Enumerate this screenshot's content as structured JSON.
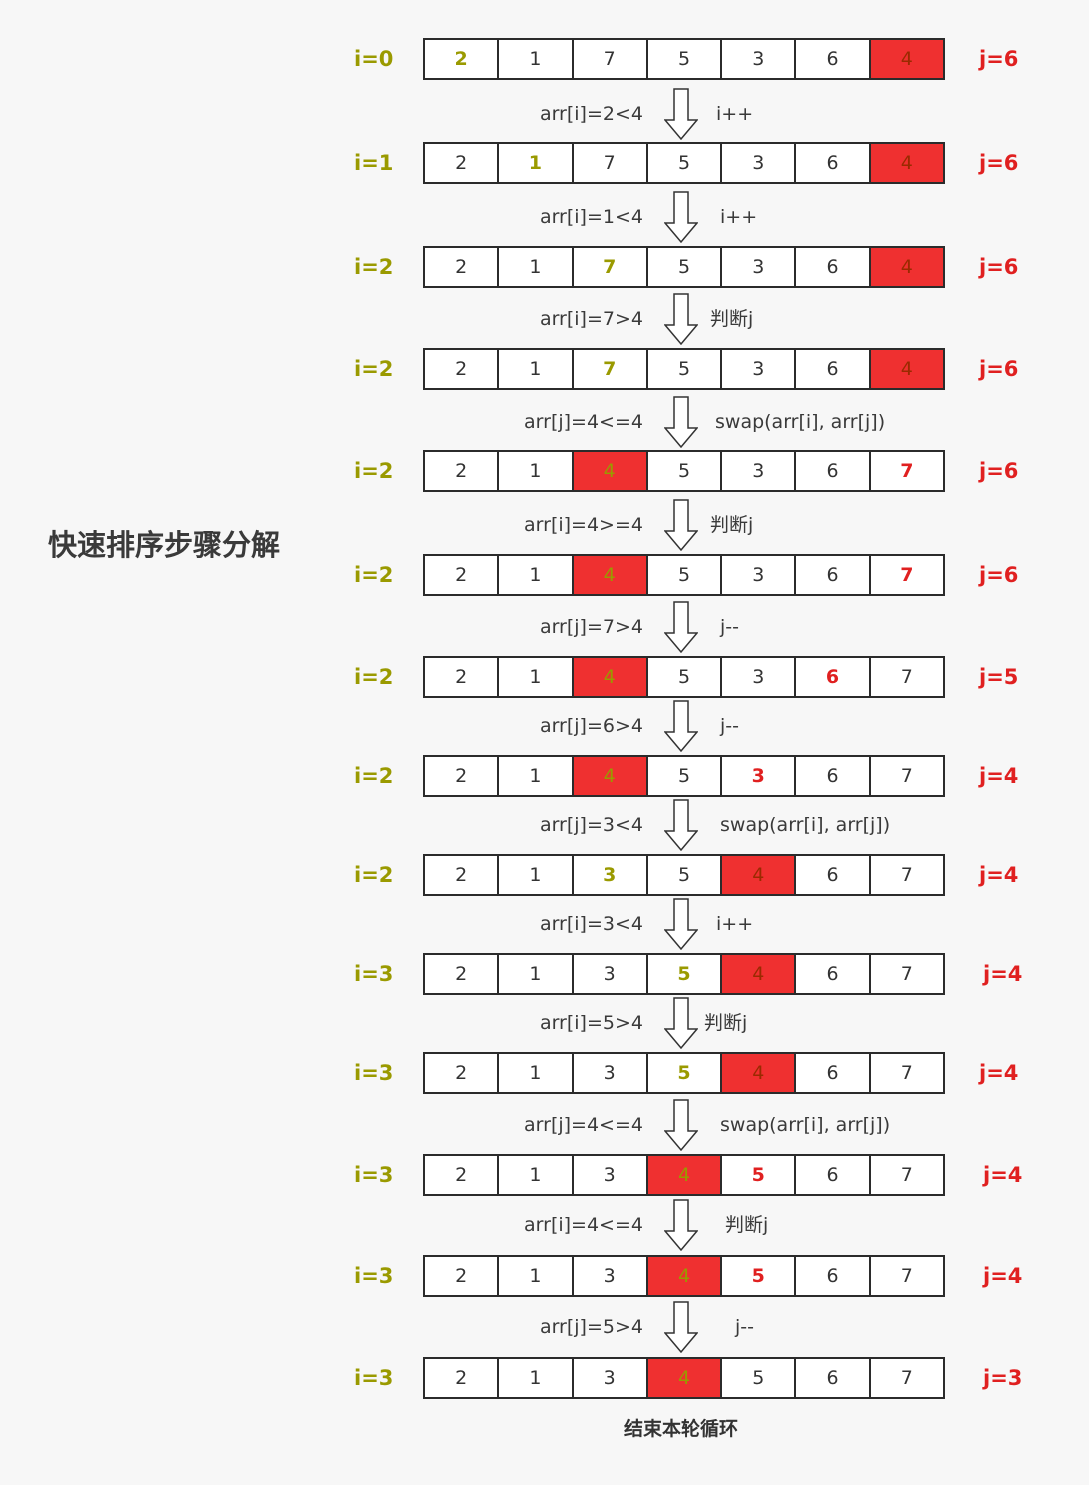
{
  "title": "快速排序步骤分解",
  "footer": "结束本轮循环",
  "colors": {
    "pivot_red": "#ef3030",
    "i_color": "#9a9a00",
    "j_color": "#e02020"
  },
  "rows": [
    {
      "i": "i=0",
      "j": "j=6",
      "cells": [
        "2",
        "1",
        "7",
        "5",
        "3",
        "6",
        "4"
      ],
      "red": [
        6
      ],
      "hi_i": 0,
      "hi_j": null
    },
    {
      "i": "i=1",
      "j": "j=6",
      "cells": [
        "2",
        "1",
        "7",
        "5",
        "3",
        "6",
        "4"
      ],
      "red": [
        6
      ],
      "hi_i": 1,
      "hi_j": null
    },
    {
      "i": "i=2",
      "j": "j=6",
      "cells": [
        "2",
        "1",
        "7",
        "5",
        "3",
        "6",
        "4"
      ],
      "red": [
        6
      ],
      "hi_i": 2,
      "hi_j": null
    },
    {
      "i": "i=2",
      "j": "j=6",
      "cells": [
        "2",
        "1",
        "7",
        "5",
        "3",
        "6",
        "4"
      ],
      "red": [
        6
      ],
      "hi_i": 2,
      "hi_j": null
    },
    {
      "i": "i=2",
      "j": "j=6",
      "cells": [
        "2",
        "1",
        "4",
        "5",
        "3",
        "6",
        "7"
      ],
      "red": [
        2
      ],
      "hi_i": 2,
      "hi_j": 6
    },
    {
      "i": "i=2",
      "j": "j=6",
      "cells": [
        "2",
        "1",
        "4",
        "5",
        "3",
        "6",
        "7"
      ],
      "red": [
        2
      ],
      "hi_i": 2,
      "hi_j": 6
    },
    {
      "i": "i=2",
      "j": "j=5",
      "cells": [
        "2",
        "1",
        "4",
        "5",
        "3",
        "6",
        "7"
      ],
      "red": [
        2
      ],
      "hi_i": 2,
      "hi_j": 5
    },
    {
      "i": "i=2",
      "j": "j=4",
      "cells": [
        "2",
        "1",
        "4",
        "5",
        "3",
        "6",
        "7"
      ],
      "red": [
        2
      ],
      "hi_i": 2,
      "hi_j": 4
    },
    {
      "i": "i=2",
      "j": "j=4",
      "cells": [
        "2",
        "1",
        "3",
        "5",
        "4",
        "6",
        "7"
      ],
      "red": [
        4
      ],
      "hi_i": 2,
      "hi_j": null
    },
    {
      "i": "i=3",
      "j": "j=4",
      "cells": [
        "2",
        "1",
        "3",
        "5",
        "4",
        "6",
        "7"
      ],
      "red": [
        4
      ],
      "hi_i": 3,
      "hi_j": null
    },
    {
      "i": "i=3",
      "j": "j=4",
      "cells": [
        "2",
        "1",
        "3",
        "5",
        "4",
        "6",
        "7"
      ],
      "red": [
        4
      ],
      "hi_i": 3,
      "hi_j": null
    },
    {
      "i": "i=3",
      "j": "j=4",
      "cells": [
        "2",
        "1",
        "3",
        "4",
        "5",
        "6",
        "7"
      ],
      "red": [
        3
      ],
      "hi_i": 3,
      "hi_j": 4
    },
    {
      "i": "i=3",
      "j": "j=4",
      "cells": [
        "2",
        "1",
        "3",
        "4",
        "5",
        "6",
        "7"
      ],
      "red": [
        3
      ],
      "hi_i": 3,
      "hi_j": 4
    },
    {
      "i": "i=3",
      "j": "j=3",
      "cells": [
        "2",
        "1",
        "3",
        "4",
        "5",
        "6",
        "7"
      ],
      "red": [
        3
      ],
      "hi_i": 3,
      "hi_j": null
    }
  ],
  "steps": [
    {
      "cond": "arr[i]=2<4",
      "action": "i++"
    },
    {
      "cond": "arr[i]=1<4",
      "action": "i++"
    },
    {
      "cond": "arr[i]=7>4",
      "action": "判断j"
    },
    {
      "cond": "arr[j]=4<=4",
      "action": "swap(arr[i], arr[j])"
    },
    {
      "cond": "arr[i]=4>=4",
      "action": "判断j"
    },
    {
      "cond": "arr[j]=7>4",
      "action": "j--"
    },
    {
      "cond": "arr[j]=6>4",
      "action": "j--"
    },
    {
      "cond": "arr[j]=3<4",
      "action": "swap(arr[i], arr[j])"
    },
    {
      "cond": "arr[i]=3<4",
      "action": "i++"
    },
    {
      "cond": "arr[i]=5>4",
      "action": "判断j"
    },
    {
      "cond": "arr[j]=4<=4",
      "action": "swap(arr[i], arr[j])"
    },
    {
      "cond": "arr[i]=4<=4",
      "action": "判断j"
    },
    {
      "cond": "arr[j]=5>4",
      "action": "j--"
    }
  ]
}
